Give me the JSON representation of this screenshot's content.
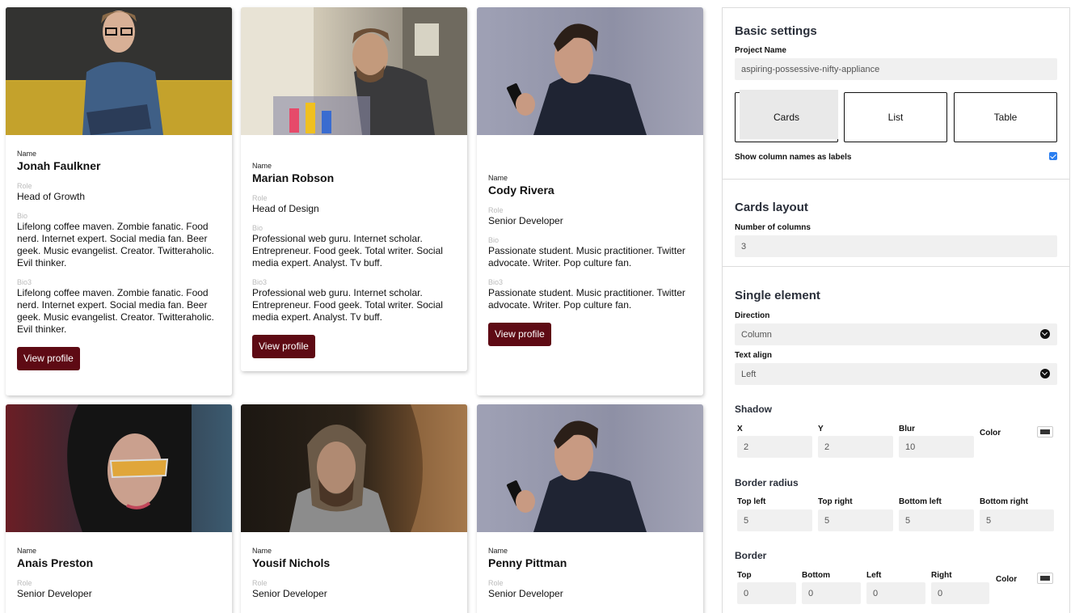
{
  "cards": [
    {
      "name_label": "Name",
      "name": "Jonah Faulkner",
      "role_label": "Role",
      "role": "Head of Growth",
      "bio_label": "Bio",
      "bio": "Lifelong coffee maven. Zombie fanatic. Food nerd. Internet expert. Social media fan. Beer geek. Music evangelist. Creator. Twitteraholic. Evil thinker.",
      "bio3_label": "Bio3",
      "bio3": "Lifelong coffee maven. Zombie fanatic. Food nerd. Internet expert. Social media fan. Beer geek. Music evangelist. Creator. Twitteraholic. Evil thinker.",
      "button": "View profile"
    },
    {
      "name_label": "Name",
      "name": "Marian Robson",
      "role_label": "Role",
      "role": "Head of Design",
      "bio_label": "Bio",
      "bio": "Professional web guru. Internet scholar. Entrepreneur. Food geek. Total writer. Social media expert. Analyst. Tv buff.",
      "bio3_label": "Bio3",
      "bio3": "Professional web guru. Internet scholar. Entrepreneur. Food geek. Total writer. Social media expert. Analyst. Tv buff.",
      "button": "View profile"
    },
    {
      "name_label": "Name",
      "name": "Cody Rivera",
      "role_label": "Role",
      "role": "Senior Developer",
      "bio_label": "Bio",
      "bio": "Passionate student. Music practitioner. Twitter advocate. Writer. Pop culture fan.",
      "bio3_label": "Bio3",
      "bio3": "Passionate student. Music practitioner. Twitter advocate. Writer. Pop culture fan.",
      "button": "View profile"
    },
    {
      "name_label": "Name",
      "name": "Anais Preston",
      "role_label": "Role",
      "role": "Senior Developer"
    },
    {
      "name_label": "Name",
      "name": "Yousif Nichols",
      "role_label": "Role",
      "role": "Senior Developer"
    },
    {
      "name_label": "Name",
      "name": "Penny Pittman",
      "role_label": "Role",
      "role": "Senior Developer"
    }
  ],
  "settings": {
    "basic": {
      "title": "Basic settings",
      "project_name_label": "Project Name",
      "project_name": "aspiring-possessive-nifty-appliance",
      "layouts": [
        "Cards",
        "List",
        "Table"
      ],
      "selected_layout": "Cards",
      "show_labels_text": "Show column names as labels",
      "show_labels_checked": true
    },
    "cards_layout": {
      "title": "Cards layout",
      "columns_label": "Number of columns",
      "columns": "3"
    },
    "single": {
      "title": "Single element",
      "direction_label": "Direction",
      "direction": "Column",
      "text_align_label": "Text align",
      "text_align": "Left",
      "shadow_title": "Shadow",
      "shadow": {
        "x_label": "X",
        "x": "2",
        "y_label": "Y",
        "y": "2",
        "blur_label": "Blur",
        "blur": "10",
        "color_label": "Color"
      },
      "radius_title": "Border radius",
      "radius": {
        "tl_label": "Top left",
        "tl": "5",
        "tr_label": "Top right",
        "tr": "5",
        "bl_label": "Bottom left",
        "bl": "5",
        "br_label": "Bottom right",
        "br": "5"
      },
      "border_title": "Border",
      "border": {
        "top_label": "Top",
        "top": "0",
        "bottom_label": "Bottom",
        "bottom": "0",
        "left_label": "Left",
        "left": "0",
        "right_label": "Right",
        "right": "0",
        "color_label": "Color"
      }
    }
  },
  "colors": {
    "button": "#5e0a14",
    "checkbox": "#2a7ef0",
    "swatch": "#333333"
  }
}
